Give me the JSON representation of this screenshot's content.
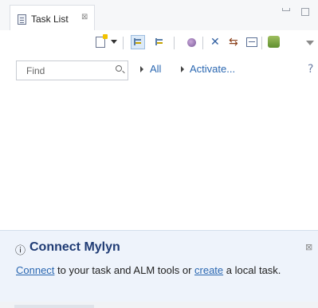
{
  "tab": {
    "title": "Task List",
    "close_glyph": "⊠"
  },
  "icons": {
    "tab": "task-list-view-icon",
    "minimize": "minimize-icon",
    "maximize": "maximize-icon",
    "new_task": "new-task-icon",
    "dropdown": "chevron-down-icon",
    "categorized": "show-categorized-icon",
    "scheduled": "show-scheduled-icon",
    "focus": "focus-on-workweek-icon",
    "collapse": "collapse-all-icon",
    "link": "link-with-editor-icon",
    "presentation": "presentation-icon",
    "sync": "synchronize-icon",
    "view_menu": "view-menu-icon",
    "search": "search-icon",
    "help": "help-icon",
    "info": "info-icon"
  },
  "toolbar": {
    "collapse_glyph": "✕",
    "link_glyph": "⇆"
  },
  "find": {
    "placeholder": "Find",
    "value": ""
  },
  "filters": {
    "all": "All",
    "activate": "Activate..."
  },
  "help_glyph": "?",
  "mylyn": {
    "info_glyph": "ⓘ",
    "title": "Connect Mylyn",
    "close_glyph": "⊠",
    "connect_link": "Connect",
    "text_1": " to your task and ALM tools or ",
    "create_link": "create",
    "text_2": " a local task."
  },
  "colors": {
    "link": "#2a67b1",
    "panel_bg": "#eef3fb",
    "title": "#1f3b74"
  }
}
